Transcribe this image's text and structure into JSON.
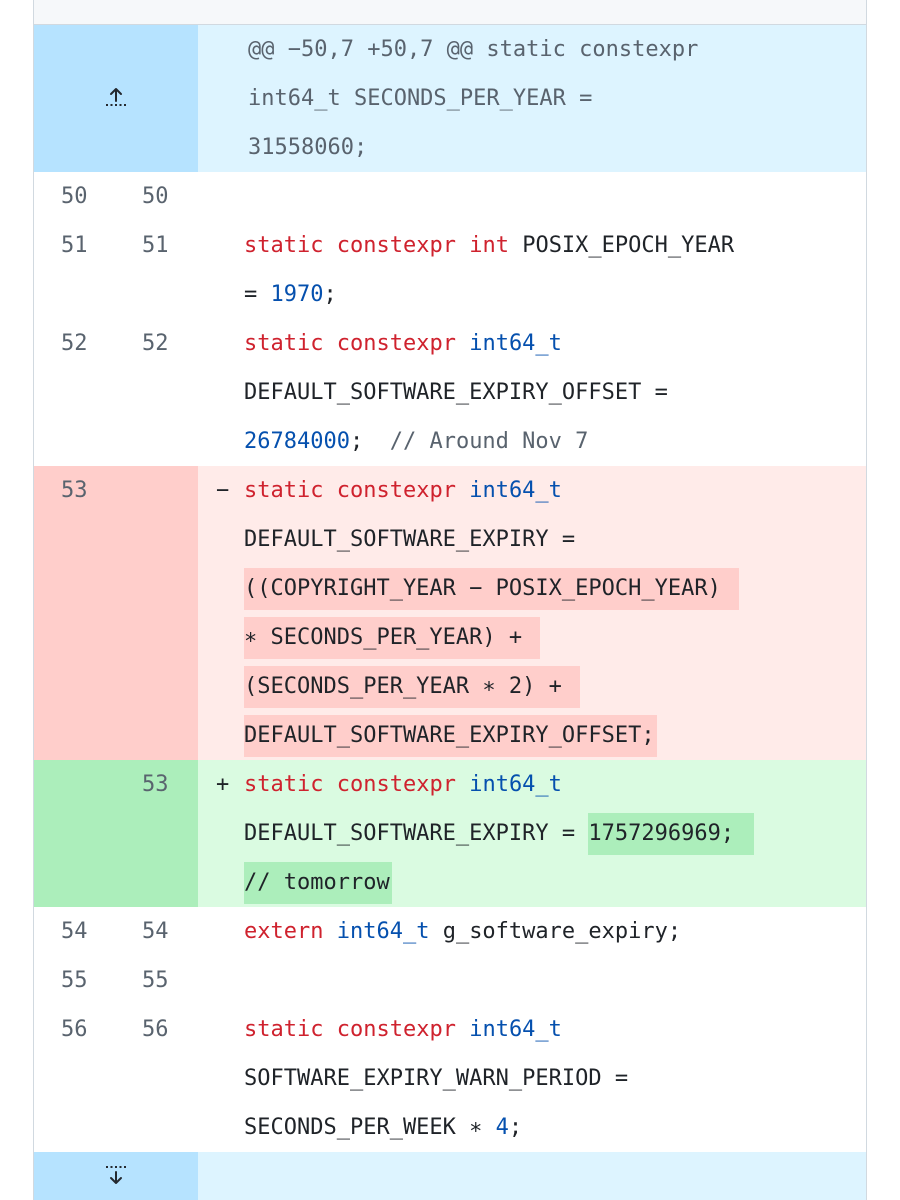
{
  "hunk": {
    "header_lines": [
      "@@ −50,7 +50,7 @@ static constexpr",
      "int64_t SECONDS_PER_YEAR =",
      "31558060;"
    ],
    "expand_up_icon": "expand-up-icon",
    "expand_down_icon": "expand-down-icon"
  },
  "lines": {
    "r50": {
      "old": "50",
      "new": "50"
    },
    "r51": {
      "old": "51",
      "new": "51",
      "kw1": "static",
      "kw2": "constexpr",
      "ty": "int",
      "rest": " POSIX_EPOCH_YEAR",
      "l2a": "= ",
      "num": "1970",
      "l2b": ";"
    },
    "r52": {
      "old": "52",
      "new": "52",
      "kw1": "static",
      "kw2": "constexpr",
      "ty": "int64_t",
      "l2": "DEFAULT_SOFTWARE_EXPIRY_OFFSET =",
      "num": "26784000",
      "l3b": ";  ",
      "cm": "// Around Nov 7"
    },
    "r53del": {
      "old": "53",
      "sign": "−",
      "kw1": "static",
      "kw2": "constexpr",
      "ty": "int64_t",
      "l2": "DEFAULT_SOFTWARE_EXPIRY =",
      "l3": "((COPYRIGHT_YEAR − POSIX_EPOCH_YEAR)",
      "l4": "∗ SECONDS_PER_YEAR) +",
      "l5": "(SECONDS_PER_YEAR ∗ 2) +",
      "l6": "DEFAULT_SOFTWARE_EXPIRY_OFFSET;"
    },
    "r53add": {
      "new": "53",
      "sign": "+",
      "kw1": "static",
      "kw2": "constexpr",
      "ty": "int64_t",
      "l2a": "DEFAULT_SOFTWARE_EXPIRY = ",
      "l2hl": "1757296969;",
      "l3": "// tomorrow"
    },
    "r54": {
      "old": "54",
      "new": "54",
      "kw": "extern",
      "ty": "int64_t",
      "rest": " g_software_expiry;"
    },
    "r55": {
      "old": "55",
      "new": "55"
    },
    "r56": {
      "old": "56",
      "new": "56",
      "kw1": "static",
      "kw2": "constexpr",
      "ty": "int64_t",
      "l2": "SOFTWARE_EXPIRY_WARN_PERIOD =",
      "l3a": "SECONDS_PER_WEEK ∗ ",
      "num": "4",
      "l3b": ";"
    }
  },
  "colors": {
    "hunk_bg": "#ddf4ff",
    "hunk_gutter": "#b6e3ff",
    "del_bg": "#ffebe9",
    "del_gutter": "#ffcecb",
    "add_bg": "#dafbe1",
    "add_gutter": "#aceebb",
    "keyword": "#cf222e",
    "type": "#0550ae",
    "comment": "#59636e"
  }
}
